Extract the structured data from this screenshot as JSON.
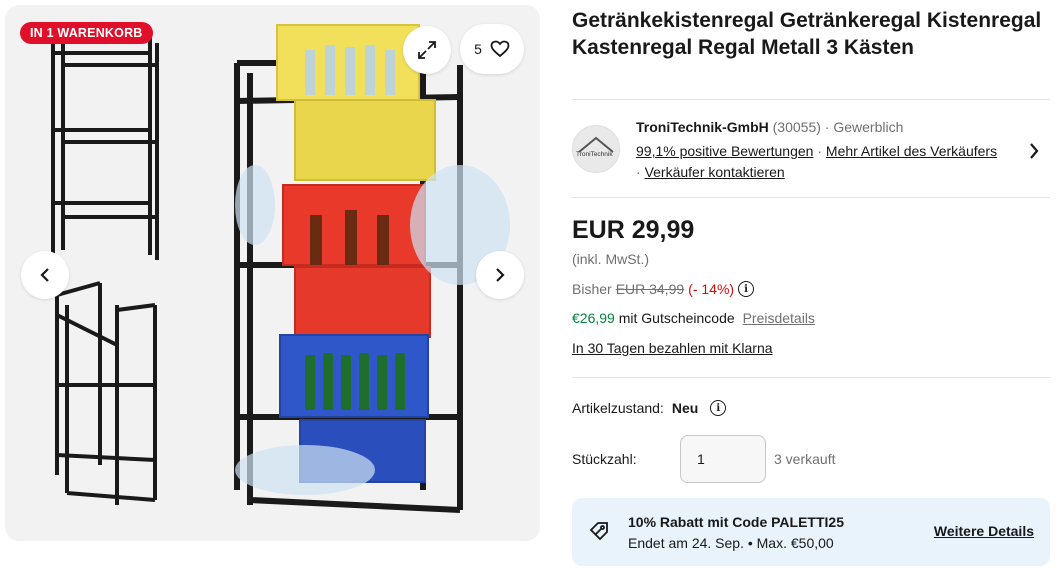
{
  "gallery": {
    "badge": "IN 1 WARENKORB",
    "watch_count": "5",
    "icons": {
      "expand": "expand-icon",
      "heart": "heart-icon",
      "prev": "chevron-left-icon",
      "next": "chevron-right-icon"
    }
  },
  "product": {
    "title": "Getränkekistenregal Getränkeregal Kistenregal Kastenregal Regal Metall 3 Kästen"
  },
  "seller": {
    "name": "TroniTechnik-GmbH",
    "feedback_count": "(30055)",
    "type": "Gewerblich",
    "positive": "99,1% positive Bewertungen",
    "more_items": "Mehr Artikel des Verkäufers",
    "contact": "Verkäufer kontaktieren",
    "logo_text": "TroniTechnik"
  },
  "price": {
    "current": "EUR 29,99",
    "vat": "(inkl. MwSt.)",
    "was_label": "Bisher",
    "was": "EUR 34,99",
    "discount": "(- 14%)",
    "coupon_price": "€26,99",
    "coupon_text": "mit Gutscheincode",
    "coupon_link": "Preisdetails",
    "klarna": "In 30 Tagen bezahlen mit Klarna"
  },
  "condition": {
    "label": "Artikelzustand:",
    "value": "Neu"
  },
  "quantity": {
    "label": "Stückzahl:",
    "value": "1",
    "sold": "3 verkauft"
  },
  "promo": {
    "title": "10% Rabatt mit Code PALETTI25",
    "sub": "Endet am 24. Sep. • Max. €50,00",
    "link": "Weitere Details"
  },
  "colors": {
    "badge": "#e0102a",
    "green": "#05823f",
    "discount": "#d50b0b",
    "promo_bg": "#e8f3fb"
  }
}
